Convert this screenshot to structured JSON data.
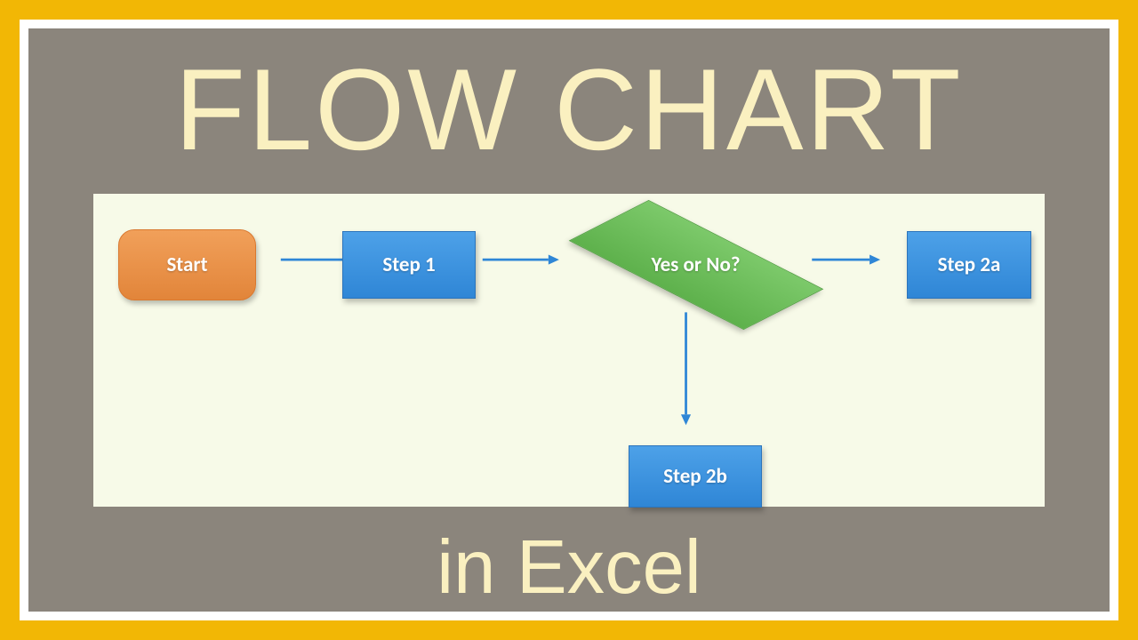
{
  "title": "FLOW CHART",
  "subtitle": "in Excel",
  "flow": {
    "start": {
      "label": "Start"
    },
    "step1": {
      "label": "Step 1"
    },
    "decision": {
      "label": "Yes or No?"
    },
    "step2a": {
      "label": "Step 2a"
    },
    "step2b": {
      "label": "Step 2b"
    }
  },
  "colors": {
    "frame": "#f2b705",
    "panel": "#8b857c",
    "canvas": "#f7fae8",
    "title_text": "#faf0c0",
    "start_fill": "#e99046",
    "process_fill": "#3d93de",
    "decision_fill": "#6cbf5a",
    "arrow": "#2f86d6"
  }
}
